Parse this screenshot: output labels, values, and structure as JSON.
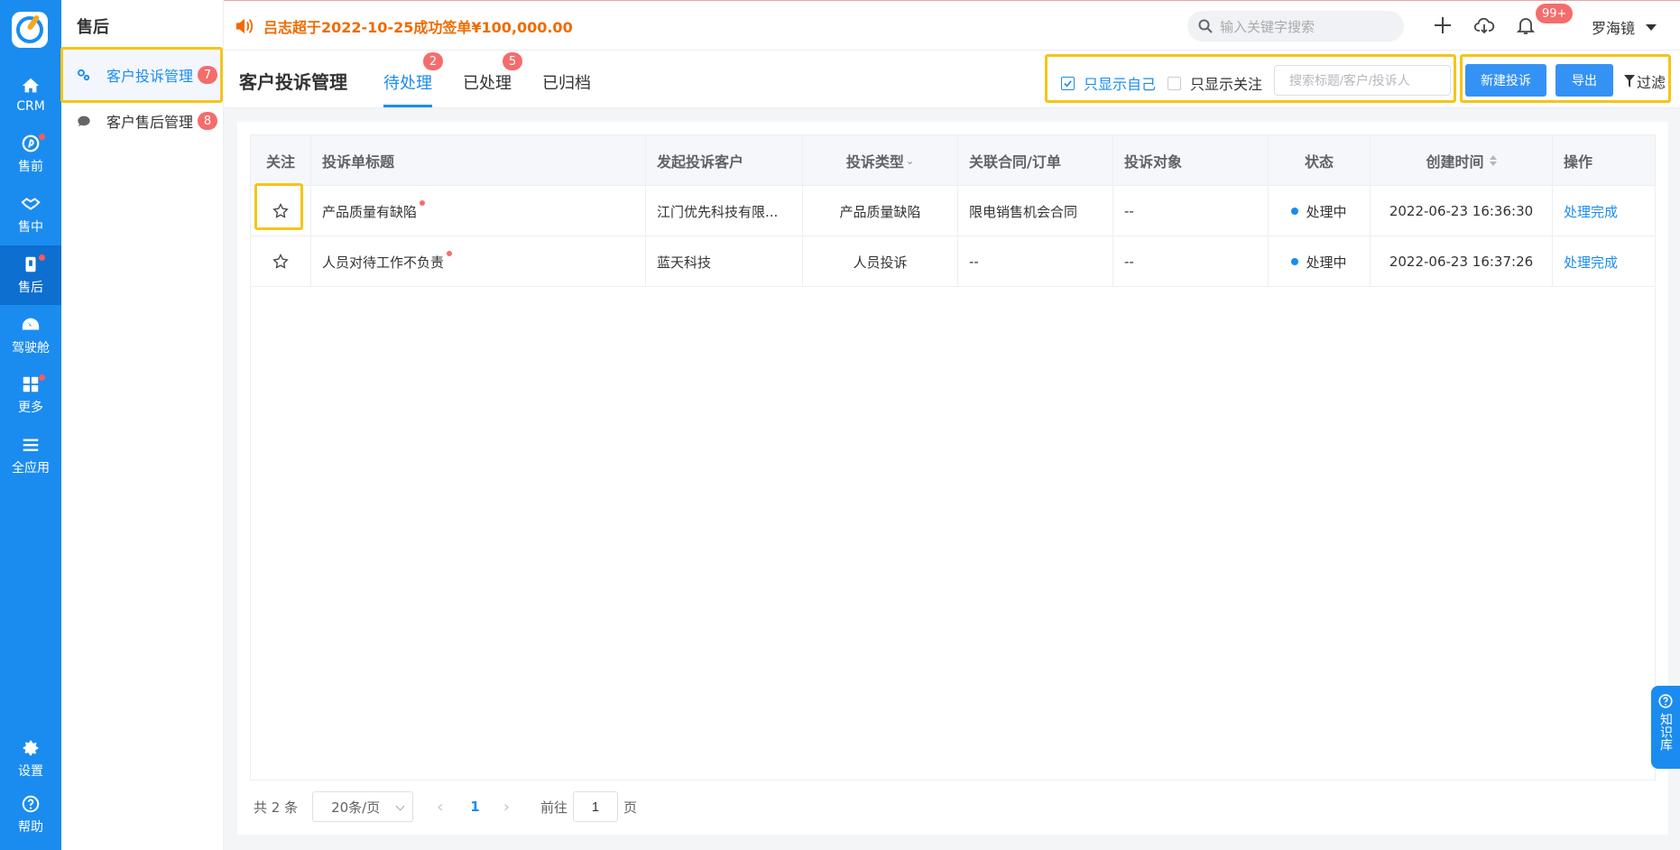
{
  "rail": {
    "items": [
      {
        "label": "CRM",
        "icon": "home-icon"
      },
      {
        "label": "售前",
        "icon": "presale-icon"
      },
      {
        "label": "售中",
        "icon": "handshake-icon"
      },
      {
        "label": "售后",
        "icon": "aftersale-icon"
      },
      {
        "label": "驾驶舱",
        "icon": "dashboard-icon"
      },
      {
        "label": "更多",
        "icon": "grid-icon"
      },
      {
        "label": "全应用",
        "icon": "menu-icon"
      },
      {
        "label": "设置",
        "icon": "gear-icon"
      },
      {
        "label": "帮助",
        "icon": "help-icon"
      }
    ]
  },
  "sidebar": {
    "title": "售后",
    "items": [
      {
        "label": "客户投诉管理",
        "badge": "7"
      },
      {
        "label": "客户售后管理",
        "badge": "8"
      }
    ]
  },
  "topbar": {
    "notice": "吕志超于2022-10-25成功签单¥100,000.00",
    "search_placeholder": "输入关键字搜索",
    "bell_badge": "99+",
    "user_name": "罗海镜"
  },
  "header": {
    "title": "客户投诉管理",
    "tabs": [
      {
        "label": "待处理",
        "badge": "2"
      },
      {
        "label": "已处理",
        "badge": "5"
      },
      {
        "label": "已归档",
        "badge": ""
      }
    ],
    "only_mine_label": "只显示自己",
    "only_followed_label": "只显示关注",
    "search_placeholder": "搜索标题/客户/投诉人",
    "new_button": "新建投诉",
    "export_button": "导出",
    "filter_label": "过滤"
  },
  "table": {
    "columns": [
      "关注",
      "投诉单标题",
      "发起投诉客户",
      "投诉类型",
      "关联合同/订单",
      "投诉对象",
      "状态",
      "创建时间",
      "操作"
    ],
    "rows": [
      {
        "title": "产品质量有缺陷",
        "customer": "江门优先科技有限...",
        "type": "产品质量缺陷",
        "contract": "限电销售机会合同",
        "target": "--",
        "status": "处理中",
        "created": "2022-06-23 16:36:30",
        "action": "处理完成"
      },
      {
        "title": "人员对待工作不负责",
        "customer": "蓝天科技",
        "type": "人员投诉",
        "contract": "--",
        "target": "--",
        "status": "处理中",
        "created": "2022-06-23 16:37:26",
        "action": "处理完成"
      }
    ]
  },
  "pager": {
    "total": "共 2 条",
    "page_size": "20条/页",
    "prev": "‹",
    "current": "1",
    "next": "›",
    "goto_prefix": "前往",
    "goto_value": "1",
    "goto_suffix": "页"
  },
  "kb": {
    "label": "知识库"
  },
  "colors": {
    "primary": "#1a8cf0",
    "badge": "#f56c6c",
    "notice": "#f06b00",
    "highlight": "#f5c518"
  }
}
